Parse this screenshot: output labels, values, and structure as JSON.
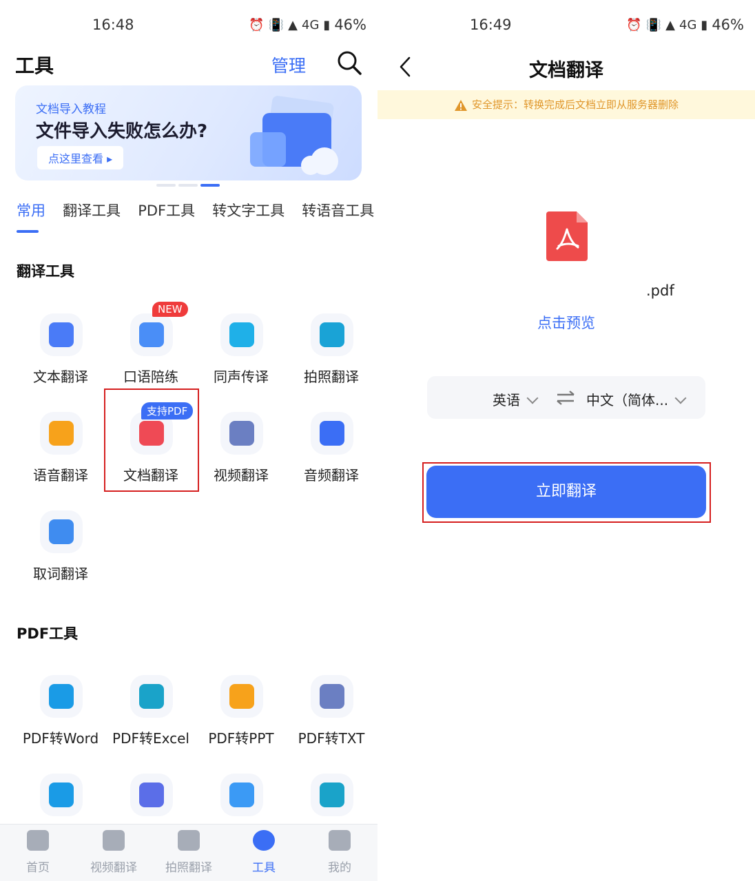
{
  "left": {
    "status": {
      "time": "16:48",
      "battery": "46%",
      "network": "4G"
    },
    "header": {
      "title": "工具",
      "manage": "管理"
    },
    "banner": {
      "subtitle": "文档导入教程",
      "headline": "文件导入失败怎么办?",
      "cta": "点这里查看"
    },
    "tabs": [
      "常用",
      "翻译工具",
      "PDF工具",
      "转文字工具",
      "转语音工具"
    ],
    "sections": [
      {
        "title": "翻译工具",
        "tools": [
          {
            "label": "文本翻译",
            "icon": "text-translate-icon",
            "color": "#4a7bf7"
          },
          {
            "label": "口语陪练",
            "icon": "speaking-practice-icon",
            "color": "#4a8ef7",
            "badge": "NEW"
          },
          {
            "label": "同声传译",
            "icon": "simultaneous-interpretation-icon",
            "color": "#1fb0e8"
          },
          {
            "label": "拍照翻译",
            "icon": "photo-translate-icon",
            "color": "#1aa3d6"
          },
          {
            "label": "语音翻译",
            "icon": "voice-translate-icon",
            "color": "#f7a21b"
          },
          {
            "label": "文档翻译",
            "icon": "document-translate-icon",
            "color": "#ef4a55",
            "badge": "支持PDF"
          },
          {
            "label": "视频翻译",
            "icon": "video-translate-icon",
            "color": "#6b7fc2"
          },
          {
            "label": "音频翻译",
            "icon": "audio-translate-icon",
            "color": "#3b6ef5"
          },
          {
            "label": "取词翻译",
            "icon": "word-pick-translate-icon",
            "color": "#3f8cf0"
          }
        ]
      },
      {
        "title": "PDF工具",
        "tools": [
          {
            "label": "PDF转Word",
            "icon": "pdf-to-word-icon",
            "color": "#1a9be6"
          },
          {
            "label": "PDF转Excel",
            "icon": "pdf-to-excel-icon",
            "color": "#1aa3c9"
          },
          {
            "label": "PDF转PPT",
            "icon": "pdf-to-ppt-icon",
            "color": "#f7a21b"
          },
          {
            "label": "PDF转TXT",
            "icon": "pdf-to-txt-icon",
            "color": "#6b7fc2"
          },
          {
            "label": "",
            "icon": "html-to-pdf-icon",
            "color": "#1a9be6"
          },
          {
            "label": "",
            "icon": "image-to-pdf-icon",
            "color": "#5b6ee8"
          },
          {
            "label": "",
            "icon": "merge-pdf-icon",
            "color": "#3b9af5"
          },
          {
            "label": "",
            "icon": "excel-to-pdf-icon",
            "color": "#1aa3c9"
          }
        ]
      }
    ],
    "bottom_nav": [
      {
        "label": "首页",
        "icon": "home-icon"
      },
      {
        "label": "视频翻译",
        "icon": "video-icon"
      },
      {
        "label": "拍照翻译",
        "icon": "camera-icon"
      },
      {
        "label": "工具",
        "icon": "tools-icon",
        "active": true
      },
      {
        "label": "我的",
        "icon": "profile-icon"
      }
    ]
  },
  "right": {
    "status": {
      "time": "16:49",
      "battery": "46%",
      "network": "4G"
    },
    "title": "文档翻译",
    "notice": "安全提示：转换完成后文档立即从服务器删除",
    "file_name": ".pdf",
    "preview": "点击预览",
    "source_lang": "英语",
    "target_lang": "中文（简体...",
    "translate_button": "立即翻译"
  },
  "colors": {
    "accent": "#3b6ef5",
    "highlight": "#d51e1e",
    "notice_bg": "#fff8dc",
    "notice_text": "#e0962a"
  }
}
